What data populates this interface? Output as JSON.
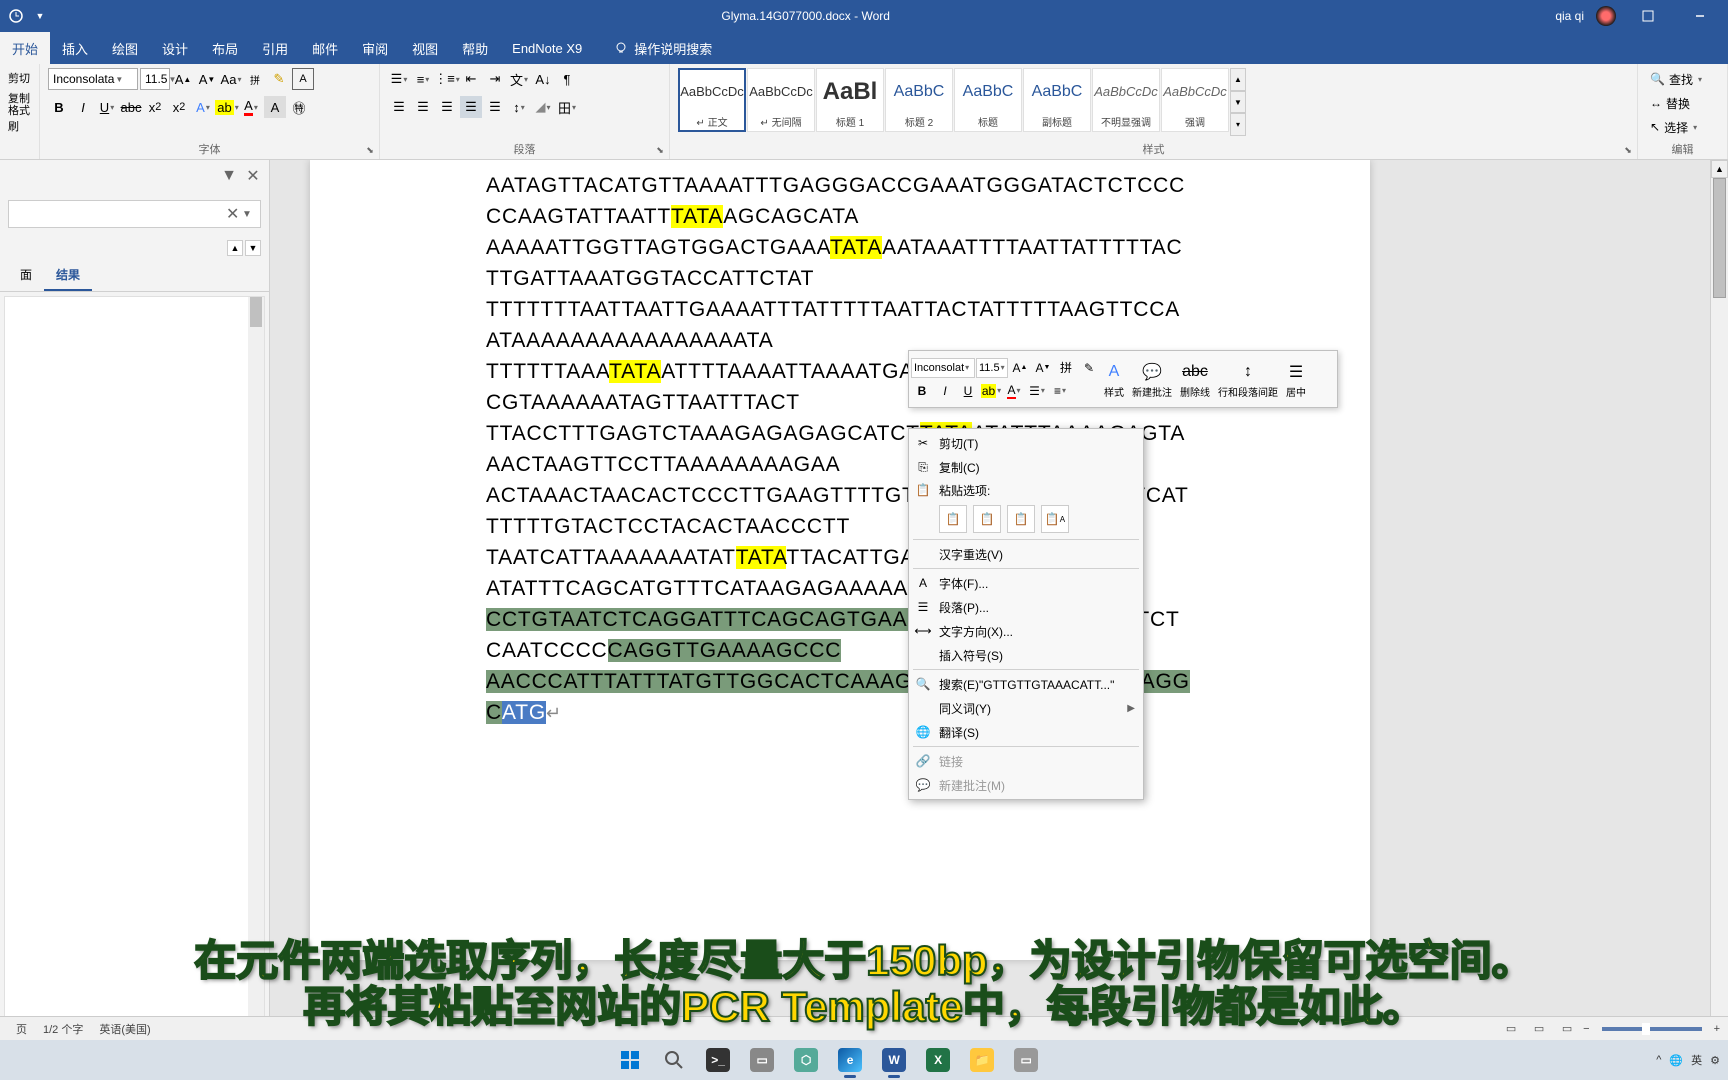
{
  "titlebar": {
    "document_title": "Glyma.14G077000.docx - Word",
    "username": "qia qi"
  },
  "ribbon_tabs": [
    "开始",
    "插入",
    "绘图",
    "设计",
    "布局",
    "引用",
    "邮件",
    "审阅",
    "视图",
    "帮助",
    "EndNote X9"
  ],
  "tell_me_placeholder": "操作说明搜索",
  "font_group": {
    "label": "字体",
    "font_name": "Inconsolata",
    "font_size": "11.5"
  },
  "clipboard": {
    "cut": "剪切",
    "copy": "复制",
    "format_painter": "格式刷"
  },
  "paragraph_group": {
    "label": "段落"
  },
  "styles_group": {
    "label": "样式",
    "items": [
      {
        "preview": "AaBbCcDc",
        "name": "↵ 正文"
      },
      {
        "preview": "AaBbCcDc",
        "name": "↵ 无间隔"
      },
      {
        "preview": "AaBl",
        "name": "标题 1"
      },
      {
        "preview": "AaBbC",
        "name": "标题 2"
      },
      {
        "preview": "AaBbC",
        "name": "标题"
      },
      {
        "preview": "AaBbC",
        "name": "副标题"
      },
      {
        "preview": "AaBbCcDc",
        "name": "不明显强调"
      },
      {
        "preview": "AaBbCcDc",
        "name": "强调"
      }
    ]
  },
  "edit_group": {
    "label": "编辑",
    "find": "查找",
    "replace": "替换",
    "select": "选择"
  },
  "nav_pane": {
    "tab_headings": "面",
    "tab_results": "结果"
  },
  "mini_toolbar": {
    "font": "Inconsolat",
    "size": "11.5",
    "styles": "样式",
    "comment": "新建批注",
    "delete_line": "删除线",
    "line_para": "行和段落间距",
    "center": "居中"
  },
  "context_menu": {
    "cut": "剪切(T)",
    "copy": "复制(C)",
    "paste_options": "粘贴选项:",
    "ime_reconvert": "汉字重选(V)",
    "font": "字体(F)...",
    "paragraph": "段落(P)...",
    "text_direction": "文字方向(X)...",
    "insert_symbol": "插入符号(S)",
    "search": "搜索(E)\"GTTGTTGTAAACATT...\"",
    "synonyms": "同义词(Y)",
    "translate": "翻译(S)",
    "link": "链接",
    "new_comment": "新建批注(M)"
  },
  "document": {
    "lines": [
      {
        "parts": [
          {
            "t": "AATAGTTACATGTTAAAATTTGAGGGACCGAAATGGGATACTCTCCCCCAAGTATTAATT"
          },
          {
            "t": "TATA",
            "hl": true
          },
          {
            "t": "AGCAGCATA"
          }
        ]
      },
      {
        "parts": [
          {
            "t": "AAAAATTGGTTAGTGGACTGAAA"
          },
          {
            "t": "TATA",
            "hl": true
          },
          {
            "t": "AATAAATTTTAATTATTTTTACTTGATTAAATGGTACCATTCTAT"
          }
        ]
      },
      {
        "parts": [
          {
            "t": "TTTTTTTAATTAATTGAAAATTTATTTTTAATTACTATTTTTAAGTTCCAATAAAAAAAAAAAAAAAATA"
          }
        ]
      },
      {
        "parts": [
          {
            "t": "TTTTTTAAA"
          },
          {
            "t": "TATA",
            "hl": true
          },
          {
            "t": "ATTTTAAAATTAAAATGACACTAATTAATCTTCTTAACGTAAAAAATAGTTAATTTACT"
          }
        ]
      },
      {
        "parts": [
          {
            "t": "TTACCTTTGAGTCTAAAGAGAGAGCATCT"
          },
          {
            "t": "TATA",
            "hl": true
          },
          {
            "t": "ATATTTAAAAGAGTAAACTAAGTTCCTTAAAAAAAAGAA"
          }
        ]
      },
      {
        "parts": [
          {
            "t": "ACTAAACTAACACTCCCTTGAAGTTTTGTGA"
          },
          {
            "t": "TATA",
            "hl": true
          },
          {
            "t": "ACACAAAAATCATTTTTTGTACTCCTACACTAACCCTT"
          }
        ]
      },
      {
        "parts": [
          {
            "t": "TAATCATTAAAAAAATAT"
          },
          {
            "t": "TATA",
            "hl": true
          },
          {
            "t": "TTACATTGAAATATC"
          }
        ]
      },
      {
        "parts": [
          {
            "t": "ATATTTCAGCATGTTTCATAAGAGAAAAA"
          },
          {
            "t": "GTTGTTGT",
            "sel": true
          }
        ]
      },
      {
        "parts": [
          {
            "t": "CCTGTAATCTCAGGATTTCAGCAGTGAAGTGATTGT",
            "sel": true
          },
          {
            "t": "ATCTATCTTCTCAATCCCC"
          },
          {
            "t": "CAGGTTGAAAAGCCC",
            "sel": true
          }
        ]
      },
      {
        "parts": [
          {
            "t": "AACCCATTTATTTATGTTGGCACTCAAAGTCAGTAG",
            "sel": true
          },
          {
            "t": "C"
          },
          {
            "t": "TGAGTTGAGGC",
            "sel": true
          },
          {
            "t": "ATG",
            "atg": true
          },
          {
            "t": "↵",
            "para": true
          }
        ]
      }
    ]
  },
  "status": {
    "page": "页",
    "word_count": "1/2 个字",
    "language": "英语(美国)"
  },
  "caption": {
    "line1": "在元件两端选取序列，长度尽量大于150bp，为设计引物保留可选空间。",
    "line2": "再将其粘贴至网站的PCR Template中，每段引物都是如此。"
  },
  "colors": {
    "word_blue": "#2b579a",
    "highlight": "#ffff00",
    "selection": "#7a9b7a",
    "caption": "#ffd700"
  }
}
